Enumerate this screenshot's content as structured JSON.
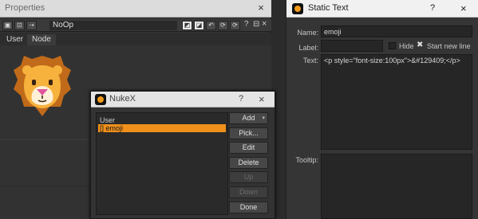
{
  "properties": {
    "title": "Properties",
    "close_glyph": "×",
    "node_name": "NoOp",
    "tabs": [
      {
        "label": "User"
      },
      {
        "label": "Node"
      }
    ],
    "toolbar_glyphs": {
      "a": "▣",
      "b": "⊡",
      "c": "⇢",
      "d": "◩",
      "e": "◪",
      "f": "↶",
      "g": "⟳",
      "h": "?",
      "i": "⊟",
      "j": "×"
    },
    "emoji_icon": "lion-face-icon"
  },
  "nukex_dialog": {
    "title": "NukeX",
    "help_glyph": "?",
    "close_glyph": "×",
    "list_items": [
      {
        "label": "User",
        "selected": false
      },
      {
        "label": "[] emoji",
        "selected": true
      }
    ],
    "buttons": [
      {
        "label": "Add",
        "has_dropdown": true,
        "enabled": true
      },
      {
        "label": "Pick...",
        "enabled": true
      },
      {
        "label": "Edit",
        "enabled": true
      },
      {
        "label": "Delete",
        "enabled": true
      },
      {
        "label": "Up",
        "enabled": false
      },
      {
        "label": "Down",
        "enabled": false
      },
      {
        "label": "Done",
        "enabled": true
      }
    ]
  },
  "static_text": {
    "title": "Static Text",
    "help_glyph": "?",
    "close_glyph": "×",
    "name_label": "Name:",
    "name_value": "emoji",
    "label_label": "Label:",
    "label_value": "",
    "hide_label": "Hide",
    "start_new_line_label": "Start new line",
    "hide_checked": false,
    "start_new_line_checked": true,
    "text_label": "Text:",
    "text_value": "<p style=\"font-size:100px\">&#129409;</p>",
    "tooltip_label": "Tooltip:",
    "tooltip_value": ""
  },
  "colors": {
    "accent": "#f0901b",
    "panel": "#323232"
  }
}
